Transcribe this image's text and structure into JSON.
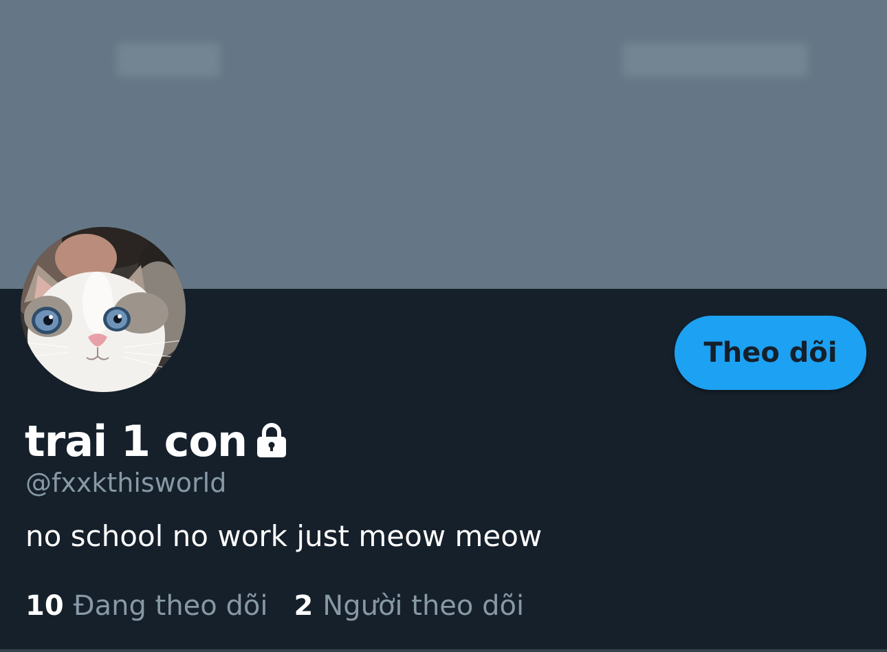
{
  "profile": {
    "display_name": "trai 1 con",
    "handle": "@fxxkthisworld",
    "bio": "no school no work just meow meow",
    "protected_icon": "lock-icon",
    "avatar_icon": "cat-avatar"
  },
  "actions": {
    "follow_label": "Theo dõi"
  },
  "stats": {
    "following_count": "10",
    "following_label": "Đang theo dõi",
    "followers_count": "2",
    "followers_label": "Người theo dõi"
  },
  "colors": {
    "background": "#15202b",
    "banner": "#657786",
    "accent": "#1da1f2",
    "secondary_text": "#8899a6"
  }
}
